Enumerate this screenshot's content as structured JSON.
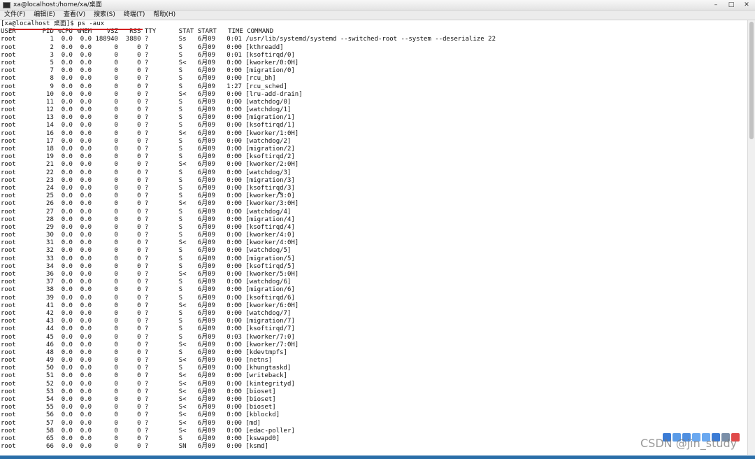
{
  "window": {
    "title": "xa@localhost:/home/xa/桌面",
    "buttons": [
      "–",
      "□",
      "✕"
    ]
  },
  "menu": [
    "文件(F)",
    "编辑(E)",
    "查看(V)",
    "搜索(S)",
    "终端(T)",
    "帮助(H)"
  ],
  "terminal": {
    "lines": [
      "[xa@localhost 桌面]$ ps -aux",
      "USER       PID %CPU %MEM    VSZ   RSS TTY      STAT START   TIME COMMAND",
      "root         1  0.0  0.0 188940  3880 ?        Ss   6月09   0:01 /usr/lib/systemd/systemd --switched-root --system --deserialize 22",
      "root         2  0.0  0.0      0     0 ?        S    6月09   0:00 [kthreadd]",
      "root         3  0.0  0.0      0     0 ?        S    6月09   0:01 [ksoftirqd/0]",
      "root         5  0.0  0.0      0     0 ?        S<   6月09   0:00 [kworker/0:0H]",
      "root         7  0.0  0.0      0     0 ?        S    6月09   0:00 [migration/0]",
      "root         8  0.0  0.0      0     0 ?        S    6月09   0:00 [rcu_bh]",
      "root         9  0.0  0.0      0     0 ?        S    6月09   1:27 [rcu_sched]",
      "root        10  0.0  0.0      0     0 ?        S<   6月09   0:00 [lru-add-drain]",
      "root        11  0.0  0.0      0     0 ?        S    6月09   0:00 [watchdog/0]",
      "root        12  0.0  0.0      0     0 ?        S    6月09   0:00 [watchdog/1]",
      "root        13  0.0  0.0      0     0 ?        S    6月09   0:00 [migration/1]",
      "root        14  0.0  0.0      0     0 ?        S    6月09   0:00 [ksoftirqd/1]",
      "root        16  0.0  0.0      0     0 ?        S<   6月09   0:00 [kworker/1:0H]",
      "root        17  0.0  0.0      0     0 ?        S    6月09   0:00 [watchdog/2]",
      "root        18  0.0  0.0      0     0 ?        S    6月09   0:00 [migration/2]",
      "root        19  0.0  0.0      0     0 ?        S    6月09   0:00 [ksoftirqd/2]",
      "root        21  0.0  0.0      0     0 ?        S<   6月09   0:00 [kworker/2:0H]",
      "root        22  0.0  0.0      0     0 ?        S    6月09   0:00 [watchdog/3]",
      "root        23  0.0  0.0      0     0 ?        S    6月09   0:00 [migration/3]",
      "root        24  0.0  0.0      0     0 ?        S    6月09   0:00 [ksoftirqd/3]",
      "root        25  0.0  0.0      0     0 ?        S    6月09   0:00 [kworker/3:0]",
      "root        26  0.0  0.0      0     0 ?        S<   6月09   0:00 [kworker/3:0H]",
      "root        27  0.0  0.0      0     0 ?        S    6月09   0:00 [watchdog/4]",
      "root        28  0.0  0.0      0     0 ?        S    6月09   0:00 [migration/4]",
      "root        29  0.0  0.0      0     0 ?        S    6月09   0:00 [ksoftirqd/4]",
      "root        30  0.0  0.0      0     0 ?        S    6月09   0:00 [kworker/4:0]",
      "root        31  0.0  0.0      0     0 ?        S<   6月09   0:00 [kworker/4:0H]",
      "root        32  0.0  0.0      0     0 ?        S    6月09   0:00 [watchdog/5]",
      "root        33  0.0  0.0      0     0 ?        S    6月09   0:00 [migration/5]",
      "root        34  0.0  0.0      0     0 ?        S    6月09   0:00 [ksoftirqd/5]",
      "root        36  0.0  0.0      0     0 ?        S<   6月09   0:00 [kworker/5:0H]",
      "root        37  0.0  0.0      0     0 ?        S    6月09   0:00 [watchdog/6]",
      "root        38  0.0  0.0      0     0 ?        S    6月09   0:00 [migration/6]",
      "root        39  0.0  0.0      0     0 ?        S    6月09   0:00 [ksoftirqd/6]",
      "root        41  0.0  0.0      0     0 ?        S<   6月09   0:00 [kworker/6:0H]",
      "root        42  0.0  0.0      0     0 ?        S    6月09   0:00 [watchdog/7]",
      "root        43  0.0  0.0      0     0 ?        S    6月09   0:00 [migration/7]",
      "root        44  0.0  0.0      0     0 ?        S    6月09   0:00 [ksoftirqd/7]",
      "root        45  0.0  0.0      0     0 ?        S    6月09   0:03 [kworker/7:0]",
      "root        46  0.0  0.0      0     0 ?        S<   6月09   0:00 [kworker/7:0H]",
      "root        48  0.0  0.0      0     0 ?        S    6月09   0:00 [kdevtmpfs]",
      "root        49  0.0  0.0      0     0 ?        S<   6月09   0:00 [netns]",
      "root        50  0.0  0.0      0     0 ?        S    6月09   0:00 [khungtaskd]",
      "root        51  0.0  0.0      0     0 ?        S<   6月09   0:00 [writeback]",
      "root        52  0.0  0.0      0     0 ?        S<   6月09   0:00 [kintegrityd]",
      "root        53  0.0  0.0      0     0 ?        S<   6月09   0:00 [bioset]",
      "root        54  0.0  0.0      0     0 ?        S<   6月09   0:00 [bioset]",
      "root        55  0.0  0.0      0     0 ?        S<   6月09   0:00 [bioset]",
      "root        56  0.0  0.0      0     0 ?        S<   6月09   0:00 [kblockd]",
      "root        57  0.0  0.0      0     0 ?        S<   6月09   0:00 [md]",
      "root        58  0.0  0.0      0     0 ?        S<   6月09   0:00 [edac-poller]",
      "root        65  0.0  0.0      0     0 ?        S    6月09   0:00 [kswapd0]",
      "root        66  0.0  0.0      0     0 ?        SN   6月09   0:00 [ksmd]"
    ]
  },
  "toolbar_icons": [
    "note-icon",
    "edit-icon",
    "pen-icon",
    "undo-icon",
    "redo-icon",
    "search-icon",
    "settings-icon",
    "record-icon"
  ],
  "watermark": "CSDN @jin_study",
  "colors": {
    "annotation_red": "#d42020",
    "taskbar": "#2b6ea8"
  }
}
